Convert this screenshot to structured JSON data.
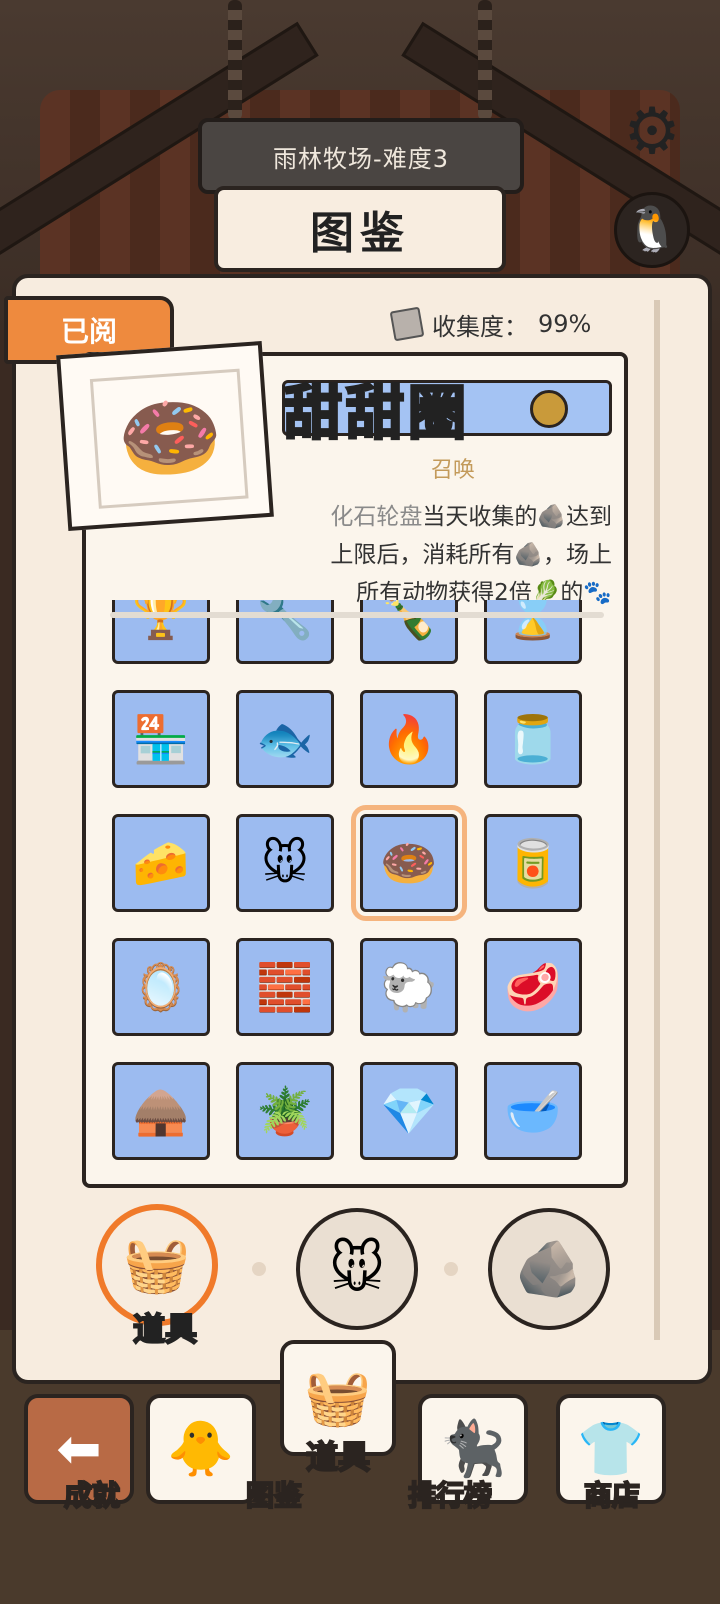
{
  "header": {
    "level_title": "雨林牧场-难度3",
    "book_title": "图鉴"
  },
  "book": {
    "read_tag": "已阅",
    "collection_label": "收集度：",
    "collection_value": "99%"
  },
  "detail": {
    "name": "甜甜圈",
    "category": "召唤",
    "desc_highlight": "化石轮盘",
    "desc_line1": "当天收集的",
    "desc_line1b": "达到",
    "desc_line2": "上限后，消耗所有",
    "desc_line2b": "，场上",
    "desc_line3": "所有动物获得2倍",
    "desc_line3b": "的"
  },
  "grid": {
    "items": [
      {
        "icon": "trophy-icon",
        "glyph": "🏆"
      },
      {
        "icon": "wrench-icon",
        "glyph": "🔧"
      },
      {
        "icon": "bottle-icon",
        "glyph": "🍾"
      },
      {
        "icon": "hourglass-icon",
        "glyph": "⌛"
      },
      {
        "icon": "shop-stall-icon",
        "glyph": "🏪"
      },
      {
        "icon": "fish-stand-icon",
        "glyph": "🐟"
      },
      {
        "icon": "fire-icon",
        "glyph": "🔥"
      },
      {
        "icon": "jars-icon",
        "glyph": "🫙"
      },
      {
        "icon": "nuggets-icon",
        "glyph": "🧀"
      },
      {
        "icon": "wind-up-mouse-icon",
        "glyph": "🐭"
      },
      {
        "icon": "donut-icon",
        "glyph": "🍩"
      },
      {
        "icon": "tin-can-icon",
        "glyph": "🥫"
      },
      {
        "icon": "mirror-icon",
        "glyph": "🪞"
      },
      {
        "icon": "building-block-icon",
        "glyph": "🧱"
      },
      {
        "icon": "sheep-hat-icon",
        "glyph": "🐑"
      },
      {
        "icon": "steak-platter-icon",
        "glyph": "🥩"
      },
      {
        "icon": "thatch-hut-icon",
        "glyph": "🛖"
      },
      {
        "icon": "seed-pot-icon",
        "glyph": "🪴"
      },
      {
        "icon": "crystal-icon",
        "glyph": "💎"
      },
      {
        "icon": "mixing-bowl-icon",
        "glyph": "🥣"
      }
    ],
    "selected_index": 10
  },
  "category_tabs": {
    "active_label": "道具",
    "tabs": [
      {
        "icon": "basket-icon",
        "glyph": "🧺"
      },
      {
        "icon": "mouse-face-icon",
        "glyph": "🐭"
      },
      {
        "icon": "rocks-icon",
        "glyph": "🪨"
      }
    ]
  },
  "nav": {
    "back_glyph": "⬅",
    "achievement_label": "成就",
    "collection_label": "图鉴",
    "items_label": "道具",
    "ranking_label": "排行榜",
    "shop_label": "商店"
  },
  "colors": {
    "accent_orange": "#ee8a3e",
    "tile_blue": "#9cbbf0",
    "page_cream": "#f7ecdf"
  }
}
